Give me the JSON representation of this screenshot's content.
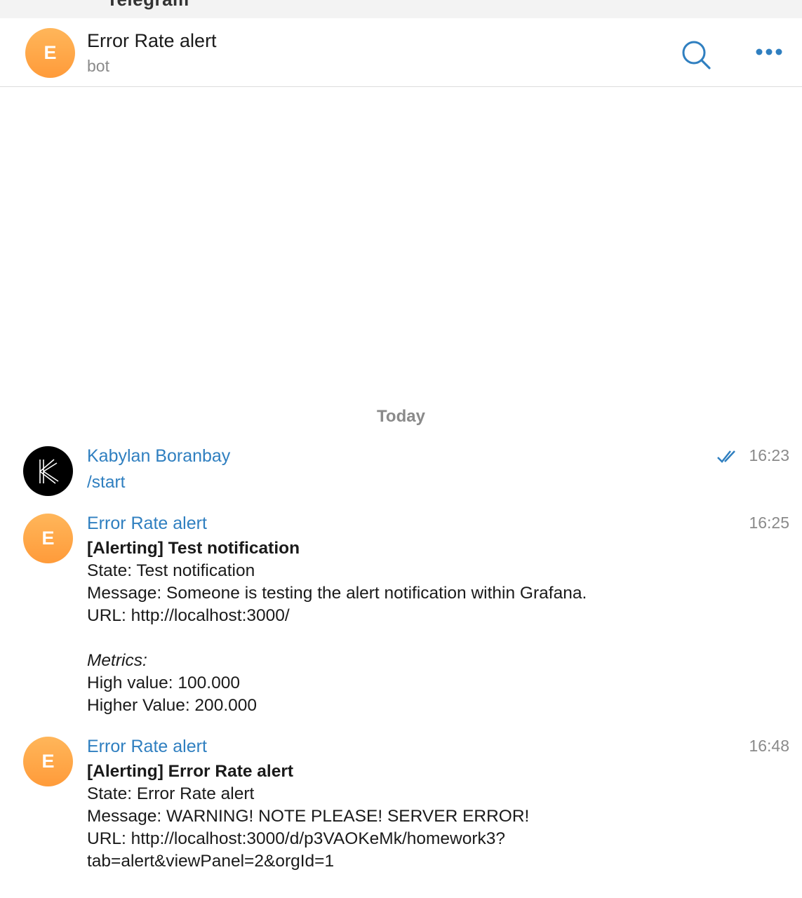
{
  "app": {
    "title": "Telegram"
  },
  "header": {
    "avatar_letter": "E",
    "title": "Error Rate alert",
    "subtitle": "bot"
  },
  "icons": {
    "search": "search-icon",
    "more": "more-horizontal-icon",
    "read": "double-check-icon",
    "user_avatar": "k-logo-icon"
  },
  "colors": {
    "accent": "#2f7fc0",
    "avatar_orange": "#ff9b3a"
  },
  "date_separator": "Today",
  "messages": [
    {
      "sender": "Kabylan Boranbay",
      "time": "16:23",
      "read": true,
      "lines": [
        "/start"
      ]
    },
    {
      "sender": "Error Rate alert",
      "time": "16:25",
      "avatar_letter": "E",
      "lines": [
        "[Alerting] Test notification",
        "State: Test notification",
        "Message: Someone is testing the alert notification within Grafana.",
        "URL: http://localhost:3000/",
        "Metrics:",
        "High value: 100.000",
        "Higher Value: 200.000"
      ]
    },
    {
      "sender": "Error Rate alert",
      "time": "16:48",
      "avatar_letter": "E",
      "lines": [
        "[Alerting] Error Rate alert",
        "State: Error Rate alert",
        "Message: WARNING! NOTE PLEASE! SERVER ERROR!",
        "URL: http://localhost:3000/d/p3VAOKeMk/homework3?",
        "tab=alert&viewPanel=2&orgId=1"
      ]
    }
  ]
}
